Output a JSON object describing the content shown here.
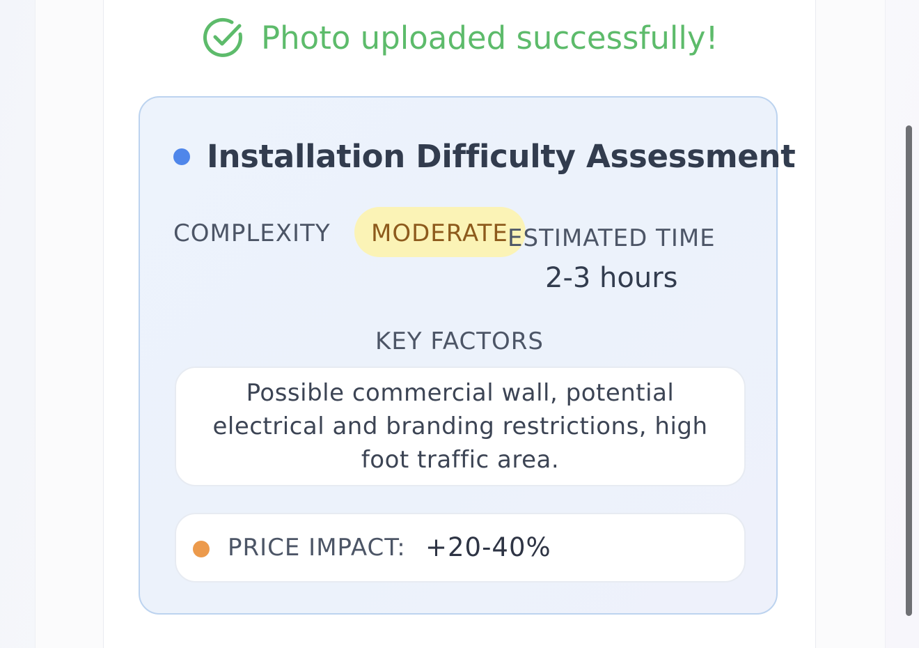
{
  "upload_status": {
    "message": "Photo uploaded successfully!",
    "icon": "check-circle-icon",
    "color": "#5dbb6b"
  },
  "assessment": {
    "title": "Installation Difficulty Assessment",
    "complexity": {
      "label": "COMPLEXITY",
      "value": "MODERATE"
    },
    "estimated_time": {
      "label": "ESTIMATED TIME",
      "value": "2-3 hours"
    },
    "key_factors": {
      "label": "KEY FACTORS",
      "text": "Possible commercial wall, potential electrical and branding restrictions, high foot traffic area."
    },
    "price_impact": {
      "label": "PRICE IMPACT:",
      "value": "+20-40%"
    }
  },
  "colors": {
    "title_dot": "#4f86ea",
    "badge_bg": "#fbf3b6",
    "badge_text": "#8d5a1c",
    "price_dot": "#ec9a4c",
    "card_border": "#bcd3ef"
  }
}
